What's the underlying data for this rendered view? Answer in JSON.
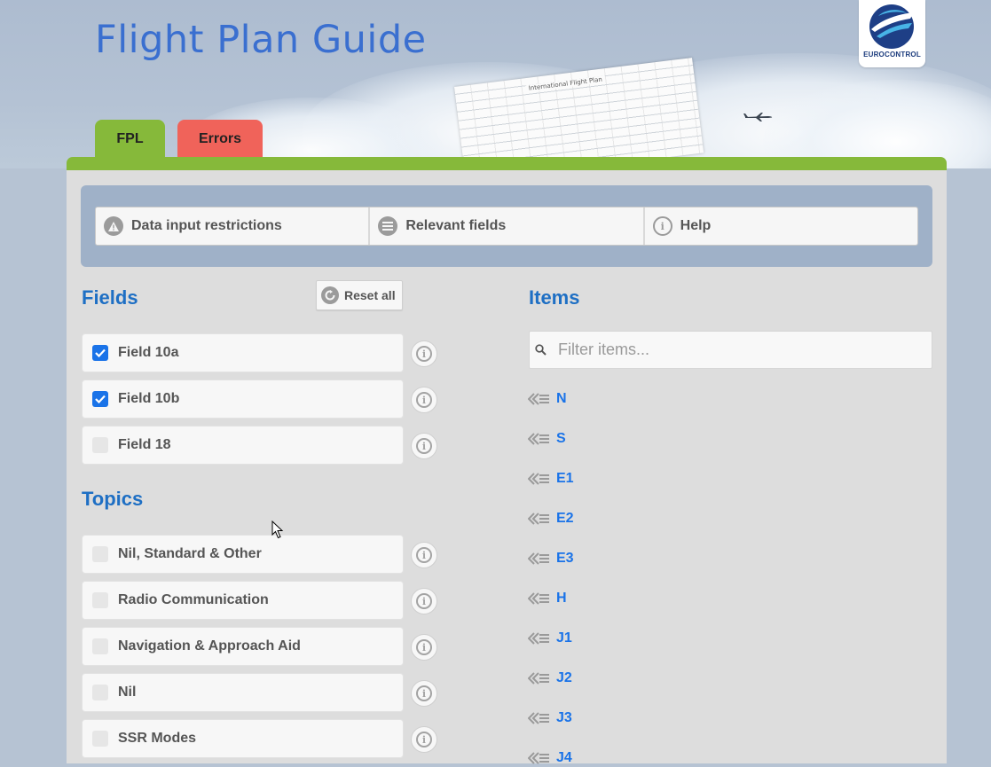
{
  "header": {
    "title": "Flight Plan Guide",
    "paper_title": "International Flight Plan",
    "logo_text": "EUROCONTROL",
    "logo_icon": "eurocontrol-logo-icon",
    "plane_icon": "airplane-icon"
  },
  "tabs": [
    {
      "label": "FPL",
      "color": "#86b93a",
      "active": true
    },
    {
      "label": "Errors",
      "color": "#f0635a",
      "active": false
    }
  ],
  "toolbar": [
    {
      "label": "Data input restrictions",
      "icon": "warning-icon"
    },
    {
      "label": "Relevant fields",
      "icon": "list-icon"
    },
    {
      "label": "Help",
      "icon": "info-icon"
    }
  ],
  "fields": {
    "heading": "Fields",
    "reset_label": "Reset all",
    "items": [
      {
        "label": "Field 10a",
        "checked": true
      },
      {
        "label": "Field 10b",
        "checked": true
      },
      {
        "label": "Field 18",
        "checked": false
      }
    ]
  },
  "topics": {
    "heading": "Topics",
    "items": [
      {
        "label": "Nil, Standard & Other",
        "checked": false
      },
      {
        "label": "Radio Communication",
        "checked": false
      },
      {
        "label": "Navigation & Approach Aid",
        "checked": false
      },
      {
        "label": "Nil",
        "checked": false
      },
      {
        "label": "SSR Modes",
        "checked": false
      }
    ]
  },
  "items": {
    "heading": "Items",
    "filter_placeholder": "Filter items...",
    "list": [
      "N",
      "S",
      "E1",
      "E2",
      "E3",
      "H",
      "J1",
      "J2",
      "J3",
      "J4"
    ]
  },
  "colors": {
    "accent_green": "#86b93a",
    "accent_red": "#f0635a",
    "heading_blue": "#1e6fc4",
    "link_blue": "#1a73e8"
  }
}
